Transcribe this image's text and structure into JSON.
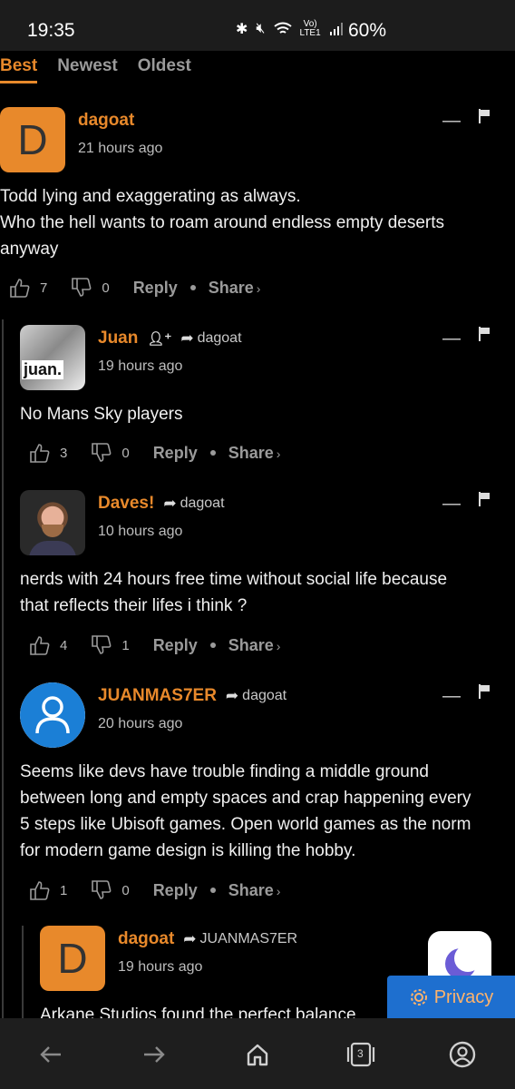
{
  "status_bar": {
    "time": "19:35",
    "lte_top": "Vo)",
    "lte_bottom": "LTE1",
    "battery": "60%"
  },
  "sort_tabs": [
    {
      "label": "Best",
      "active": true
    },
    {
      "label": "Newest",
      "active": false
    },
    {
      "label": "Oldest",
      "active": false
    }
  ],
  "comments": [
    {
      "author": "dagoat",
      "avatar_letter": "D",
      "time": "21 hours ago",
      "body": [
        "Todd lying and exaggerating as always.",
        "Who the hell wants to roam around endless empty deserts",
        "anyway"
      ],
      "upvotes": "7",
      "downvotes": "0",
      "reply_label": "Reply",
      "share_label": "Share"
    },
    {
      "author": "Juan",
      "avatar_text": "juan.",
      "reply_to": "dagoat",
      "time": "19 hours ago",
      "body": [
        "No Mans Sky players"
      ],
      "upvotes": "3",
      "downvotes": "0",
      "reply_label": "Reply",
      "share_label": "Share"
    },
    {
      "author": "Daves!",
      "reply_to": "dagoat",
      "time": "10 hours ago",
      "body": [
        "nerds with 24 hours free time without social life because",
        "that reflects their lifes i think ?"
      ],
      "upvotes": "4",
      "downvotes": "1",
      "reply_label": "Reply",
      "share_label": "Share"
    },
    {
      "author": "JUANMAS7ER",
      "reply_to": "dagoat",
      "time": "20 hours ago",
      "body": [
        "Seems like devs have trouble finding a middle ground",
        "between long and empty spaces and crap happening every",
        "5 steps like Ubisoft games. Open world games as the norm",
        "for modern game design is killing the hobby."
      ],
      "upvotes": "1",
      "downvotes": "0",
      "reply_label": "Reply",
      "share_label": "Share"
    },
    {
      "author": "dagoat",
      "avatar_letter": "D",
      "reply_to": "JUANMAS7ER",
      "time": "19 hours ago",
      "body": [
        "Arkane Studios found the perfect balance"
      ]
    }
  ],
  "privacy_label": "Privacy",
  "nav": {
    "tabs_count": "3"
  },
  "colors": {
    "accent": "#e8892b",
    "privacy_bg": "#1e6fcf",
    "background": "#000000"
  }
}
